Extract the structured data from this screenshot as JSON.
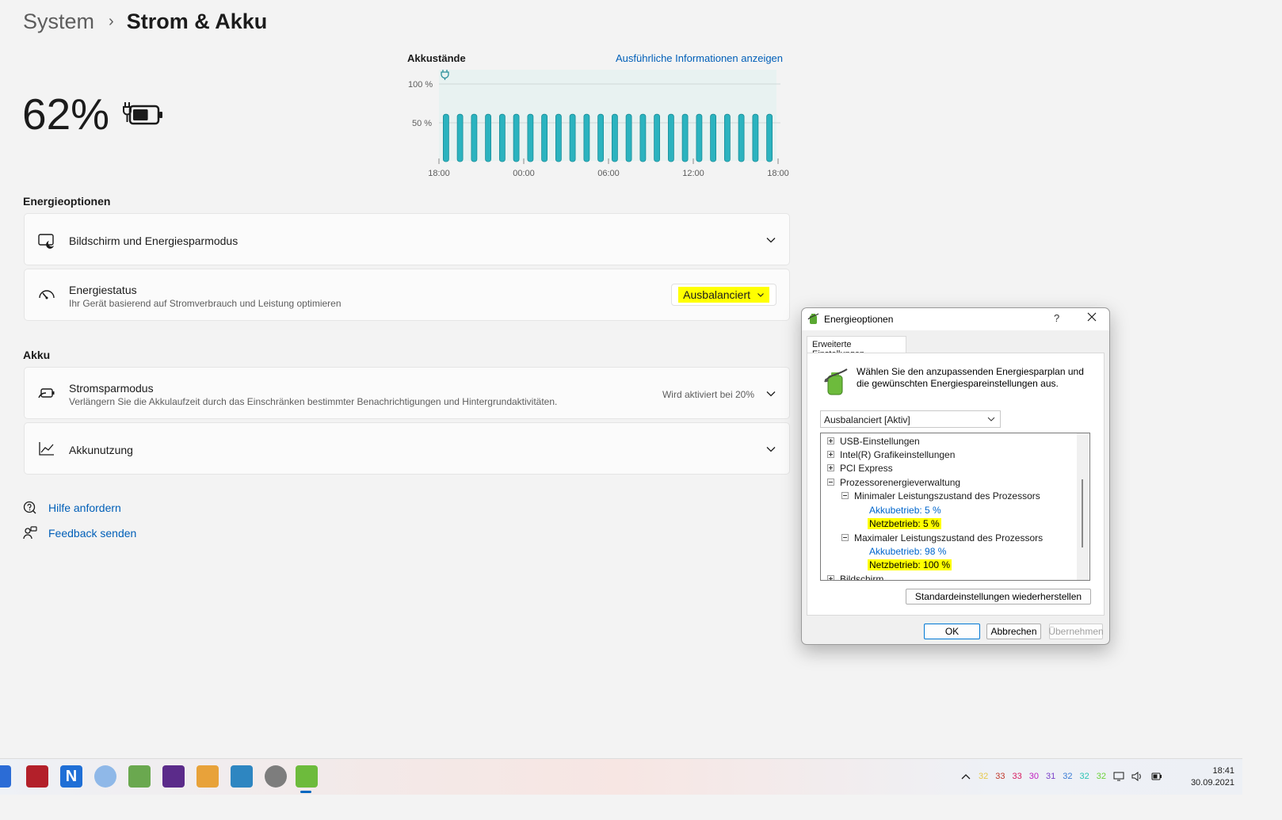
{
  "breadcrumb": {
    "parent": "System",
    "separator": "›",
    "current": "Strom & Akku"
  },
  "battery": {
    "percent": "62%",
    "level": 0.62
  },
  "chart_card": {
    "title": "Akkustände",
    "link": "Ausführliche Informationen anzeigen"
  },
  "chart_data": {
    "type": "bar",
    "ylabel": "",
    "yticks": [
      "100 %",
      "50 %"
    ],
    "xticks": [
      "18:00",
      "00:00",
      "06:00",
      "12:00",
      "18:00"
    ],
    "ylim": [
      0,
      100
    ],
    "charging": true,
    "values": [
      61,
      61,
      61,
      61,
      61,
      61,
      61,
      61,
      61,
      61,
      61,
      61,
      61,
      61,
      61,
      61,
      61,
      61,
      61,
      61,
      61,
      61,
      61,
      61
    ]
  },
  "energy_section": {
    "heading": "Energieoptionen"
  },
  "screen_card": {
    "title": "Bildschirm und Energiesparmodus"
  },
  "power_mode_card": {
    "title": "Energiestatus",
    "subtitle": "Ihr Gerät basierend auf Stromverbrauch und Leistung optimieren",
    "selected": "Ausbalanciert"
  },
  "battery_section": {
    "heading": "Akku"
  },
  "saver_card": {
    "title": "Stromsparmodus",
    "subtitle": "Verlängern Sie die Akkulaufzeit durch das Einschränken bestimmter Benachrichtigungen und Hintergrundaktivitäten.",
    "status": "Wird aktiviert bei 20%"
  },
  "usage_card": {
    "title": "Akkunutzung"
  },
  "links": {
    "help": "Hilfe anfordern",
    "feedback": "Feedback senden"
  },
  "dialog": {
    "title": "Energieoptionen",
    "help": "?",
    "tab": "Erweiterte Einstellungen",
    "description": "Wählen Sie den anzupassenden Energiesparplan und die gewünschten Energiespareinstellungen aus.",
    "plan": "Ausbalanciert [Aktiv]",
    "tree": {
      "usb": "USB-Einstellungen",
      "intel": "Intel(R) Grafikeinstellungen",
      "pci": "PCI Express",
      "cpu": "Prozessorenergieverwaltung",
      "min": "Minimaler Leistungszustand des Prozessors",
      "min_battery_label": "Akkubetrieb:",
      "min_battery_value": "5 %",
      "min_ac_label": "Netzbetrieb:",
      "min_ac_value": "5 %",
      "max": "Maximaler Leistungszustand des Prozessors",
      "max_battery_label": "Akkubetrieb:",
      "max_battery_value": "98 %",
      "max_ac_label": "Netzbetrieb:",
      "max_ac_value": "100 %",
      "screen": "Bildschirm"
    },
    "restore": "Standardeinstellungen wiederherstellen",
    "ok": "OK",
    "cancel": "Abbrechen",
    "apply": "Übernehmen"
  },
  "taskbar": {
    "tray_numbers": [
      {
        "text": "32",
        "color": "#e6c84a"
      },
      {
        "text": "33",
        "color": "#c0392b"
      },
      {
        "text": "33",
        "color": "#d81b60"
      },
      {
        "text": "30",
        "color": "#c020c0"
      },
      {
        "text": "31",
        "color": "#7a3fc9"
      },
      {
        "text": "32",
        "color": "#3a7bd5"
      },
      {
        "text": "32",
        "color": "#2bc4b4"
      },
      {
        "text": "32",
        "color": "#6bd13a"
      }
    ],
    "time": "18:41",
    "date": "30.09.2021"
  },
  "colors": {
    "accent": "#005fb8",
    "highlight": "#ffff00",
    "bar": "#2bb3bf"
  }
}
